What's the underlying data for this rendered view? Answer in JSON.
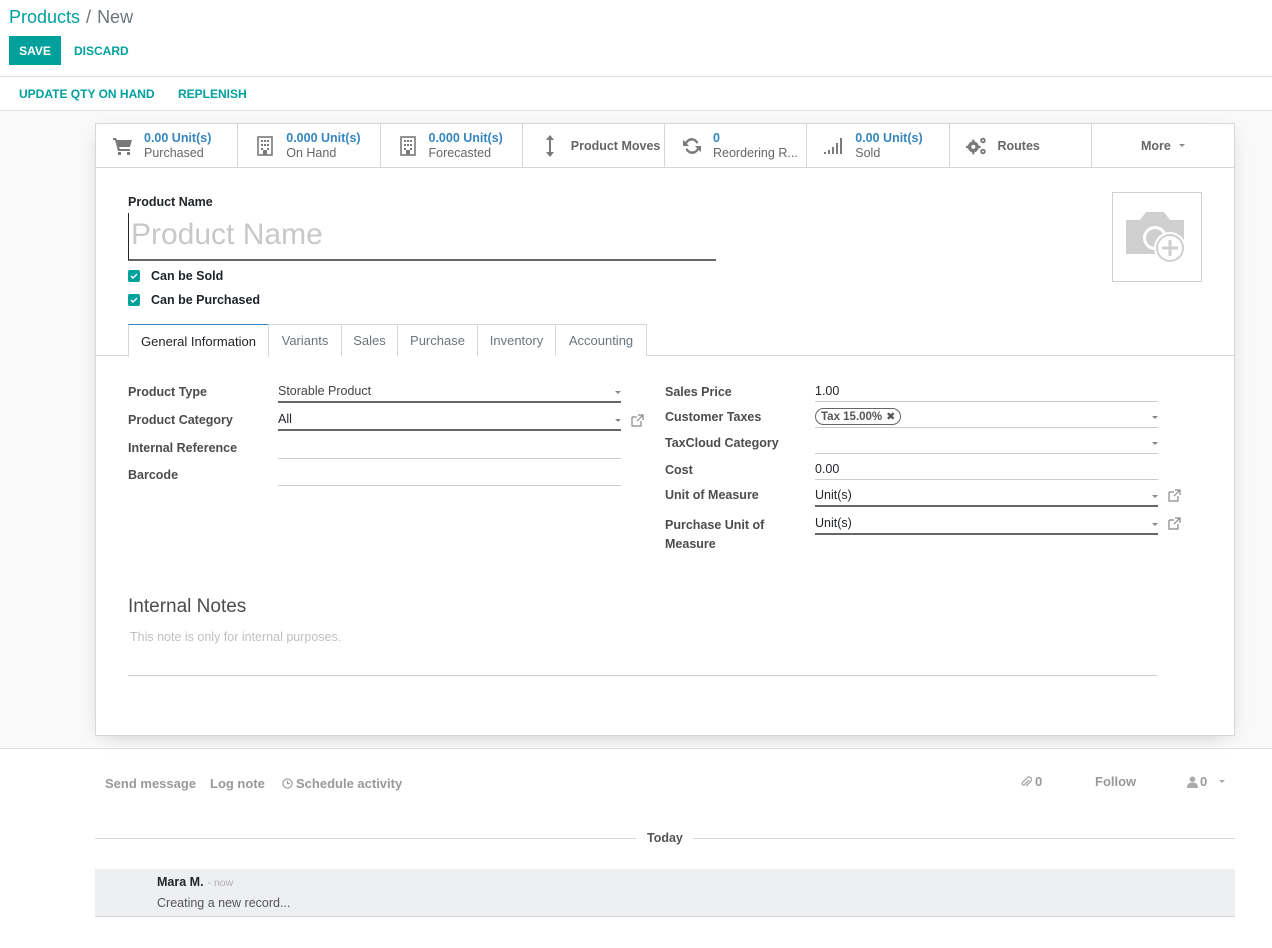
{
  "breadcrumb": {
    "parent": "Products",
    "separator": "/",
    "current": "New"
  },
  "toolbar": {
    "save_label": "SAVE",
    "discard_label": "DISCARD"
  },
  "statusbar": {
    "update_qty_label": "UPDATE QTY ON HAND",
    "replenish_label": "REPLENISH"
  },
  "smart_buttons": [
    {
      "icon": "cart-icon",
      "value": "0.00 Unit(s)",
      "label": "Purchased"
    },
    {
      "icon": "building-icon",
      "value": "0.000 Unit(s)",
      "label": "On Hand"
    },
    {
      "icon": "building-icon",
      "value": "0.000 Unit(s)",
      "label": "Forecasted"
    },
    {
      "icon": "arrows-vertical-icon",
      "label": "Product Moves"
    },
    {
      "icon": "refresh-icon",
      "value": "0",
      "label": "Reordering R..."
    },
    {
      "icon": "signal-icon",
      "value": "0.00 Unit(s)",
      "label": "Sold"
    },
    {
      "icon": "gears-icon",
      "label": "Routes"
    },
    {
      "label": "More"
    }
  ],
  "product": {
    "name_label": "Product Name",
    "name_placeholder": "Product Name",
    "can_be_sold_label": "Can be Sold",
    "can_be_sold": true,
    "can_be_purchased_label": "Can be Purchased",
    "can_be_purchased": true
  },
  "tabs": [
    {
      "label": "General Information",
      "active": true
    },
    {
      "label": "Variants"
    },
    {
      "label": "Sales"
    },
    {
      "label": "Purchase"
    },
    {
      "label": "Inventory"
    },
    {
      "label": "Accounting"
    }
  ],
  "general": {
    "left": [
      {
        "label": "Product Type",
        "value": "Storable Product"
      },
      {
        "label": "Product Category",
        "value": "All"
      },
      {
        "label": "Internal Reference",
        "value": ""
      },
      {
        "label": "Barcode",
        "value": ""
      }
    ],
    "right": [
      {
        "label": "Sales Price",
        "value": "1.00"
      },
      {
        "label": "Customer Taxes",
        "tag": "Tax 15.00%"
      },
      {
        "label": "TaxCloud Category",
        "value": ""
      },
      {
        "label": "Cost",
        "value": "0.00"
      },
      {
        "label": "Unit of Measure",
        "value": "Unit(s)"
      },
      {
        "label": "Purchase Unit of Measure",
        "value": "Unit(s)"
      }
    ]
  },
  "notes": {
    "title": "Internal Notes",
    "placeholder": "This note is only for internal purposes."
  },
  "chatter": {
    "send_message": "Send message",
    "log_note": "Log note",
    "schedule_activity": "Schedule activity",
    "attachments_count": "0",
    "follow": "Follow",
    "followers_count": "0",
    "date_separator": "Today",
    "messages": [
      {
        "author": "Mara M.",
        "time": "- now",
        "body": "Creating a new record..."
      }
    ]
  },
  "colors": {
    "primary": "#00A09D",
    "stat_value": "#3586bf"
  }
}
